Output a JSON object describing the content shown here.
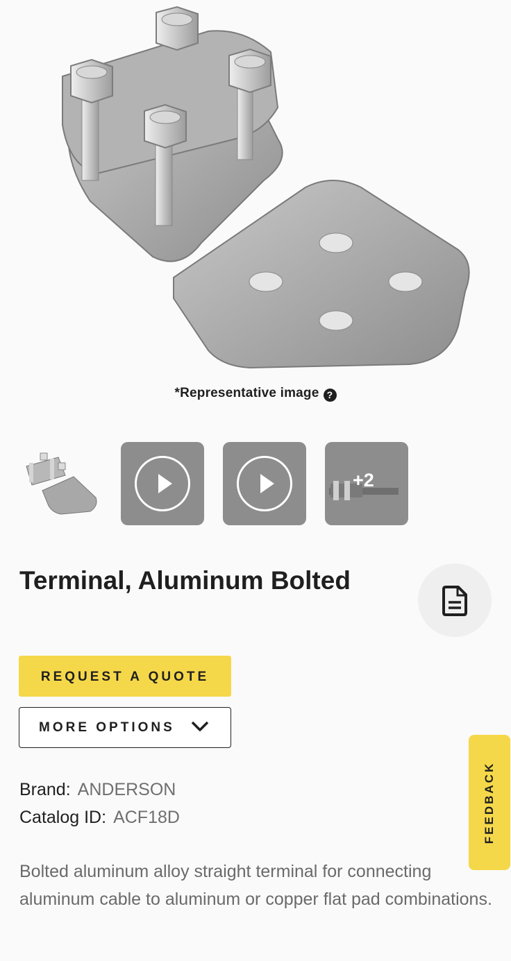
{
  "image_caption": "*Representative image",
  "help_icon": "?",
  "thumbnails": [
    {
      "kind": "image"
    },
    {
      "kind": "video"
    },
    {
      "kind": "video"
    },
    {
      "kind": "more",
      "label": "+2"
    }
  ],
  "product": {
    "title": "Terminal, Aluminum Bolted",
    "brand_label": "Brand:",
    "brand_value": "ANDERSON",
    "catalog_label": "Catalog ID:",
    "catalog_value": "ACF18D",
    "description": "Bolted aluminum alloy straight terminal for connecting aluminum cable to aluminum or copper flat pad combinations."
  },
  "actions": {
    "request_quote": "REQUEST A QUOTE",
    "more_options": "MORE OPTIONS"
  },
  "feedback_tab": "FEEDBACK",
  "colors": {
    "accent": "#f5d84a",
    "text": "#1f1f1f",
    "muted": "#6f6f6f",
    "thumb_bg": "#8d8d8d"
  },
  "icons": [
    "help-icon",
    "play-icon",
    "document-icon",
    "chevron-down-icon"
  ]
}
